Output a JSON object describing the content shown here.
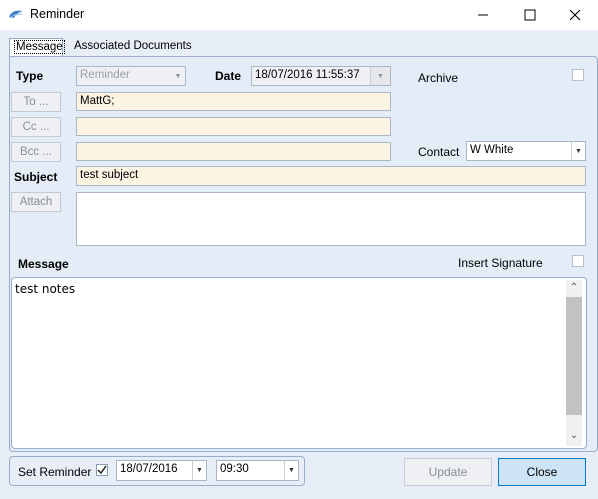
{
  "window": {
    "title": "Reminder",
    "minimize_icon": "minimize-icon",
    "maximize_icon": "maximize-icon",
    "close_icon": "close-icon"
  },
  "tabs": [
    {
      "label": "Message"
    },
    {
      "label": "Associated Documents"
    }
  ],
  "form": {
    "type_label": "Type",
    "type_value": "Reminder",
    "date_label": "Date",
    "date_value": "18/07/2016 11:55:37",
    "archive_label": "Archive",
    "to_button": "To ...",
    "to_value": "MattG;",
    "cc_button": "Cc ...",
    "cc_value": "",
    "bcc_button": "Bcc ...",
    "bcc_value": "",
    "contact_label": "Contact",
    "contact_value": "W White",
    "subject_label": "Subject",
    "subject_value": "test subject",
    "attach_button": "Attach",
    "message_label": "Message",
    "insert_signature_label": "Insert Signature",
    "message_body": "test notes"
  },
  "footer": {
    "set_reminder_label": "Set Reminder",
    "set_reminder_checked": true,
    "reminder_date": "18/07/2016",
    "reminder_time": "09:30",
    "update_button": "Update",
    "close_button": "Close"
  },
  "colors": {
    "accent": "#0078d7",
    "panel": "#e4ecf7",
    "field": "#fcf3e3"
  }
}
